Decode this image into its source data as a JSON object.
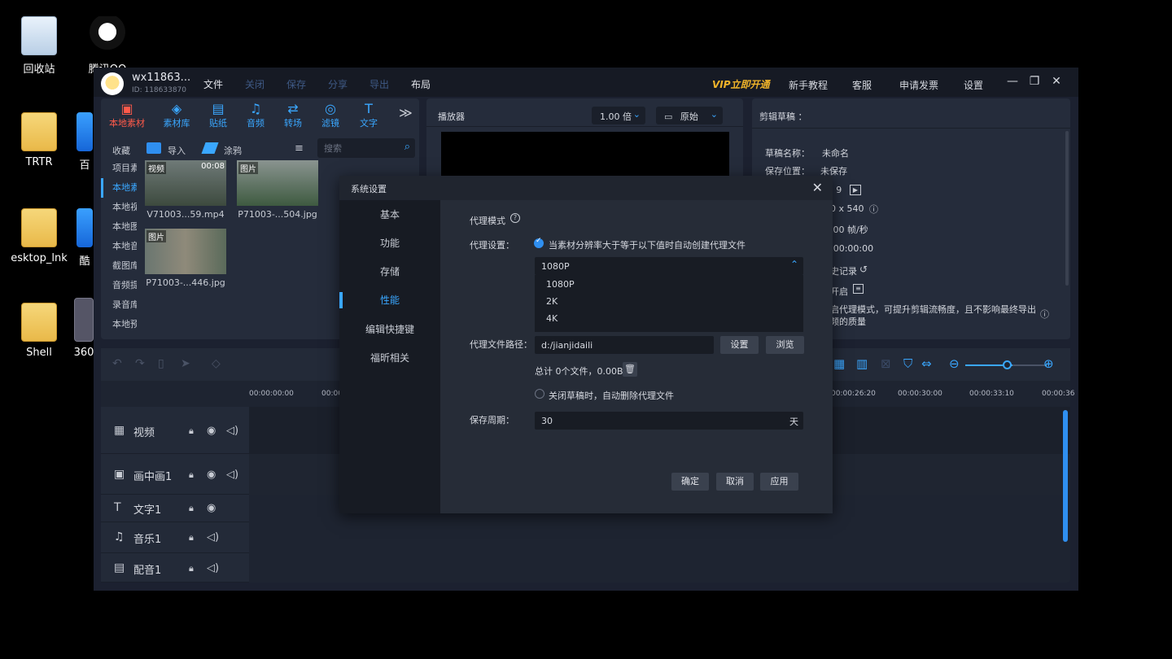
{
  "desktop": {
    "icons": [
      {
        "label": "回收站"
      },
      {
        "label": "腾讯QQ"
      },
      {
        "label": "TRTR"
      },
      {
        "label": "百"
      },
      {
        "label": "esktop_lnk"
      },
      {
        "label": "酷"
      },
      {
        "label": "Shell"
      },
      {
        "label": "360"
      }
    ]
  },
  "app": {
    "user": {
      "name": "wx11863...",
      "id": "ID: 118633870"
    },
    "menu": [
      "文件",
      "关闭",
      "保存",
      "分享",
      "导出",
      "布局"
    ],
    "vip": "VIP立即开通",
    "top_links": [
      "新手教程",
      "客服",
      "申请发票",
      "设置"
    ],
    "win_buttons": [
      "—",
      "❐",
      "✕"
    ]
  },
  "library": {
    "tabs": [
      {
        "label": "本地素材",
        "icon": "▣"
      },
      {
        "label": "素材库",
        "icon": "◈"
      },
      {
        "label": "贴纸",
        "icon": "▤"
      },
      {
        "label": "音频",
        "icon": "♫"
      },
      {
        "label": "转场",
        "icon": "⇄"
      },
      {
        "label": "滤镜",
        "icon": "◎"
      },
      {
        "label": "文字",
        "icon": "T"
      }
    ],
    "more": "≫",
    "collect": "收藏",
    "import": "导入",
    "brush": "涂鸦",
    "sort_icon": "≡",
    "search_placeholder": "搜索",
    "side": [
      "项目素",
      "本地素",
      "本地视",
      "本地图",
      "本地音",
      "截图库",
      "音频提",
      "录音库",
      "本地预"
    ],
    "items": [
      {
        "tag": "视频",
        "duration": "00:08",
        "caption": "V71003...59.mp4"
      },
      {
        "tag": "图片",
        "duration": "",
        "caption": "P71003-...504.jpg"
      },
      {
        "tag": "图片",
        "duration": "",
        "caption": "P71003-...446.jpg"
      }
    ]
  },
  "player": {
    "title": "播放器",
    "speed": "1.00 倍",
    "ratio": "原始"
  },
  "draft": {
    "title": "剪辑草稿",
    "colon": "：",
    "name_label": "草稿名称：",
    "name_value": "未命名",
    "location_label": "保存位置：",
    "location_value": "未保存",
    "partial": [
      ": 9",
      "0 x 540",
      ".00 帧/秒",
      ":00:00:00",
      "史记录",
      "开启"
    ],
    "desc_1": "启代理模式，可提升剪辑流畅度，且不影响最终导出",
    "desc_2": "频的质量"
  },
  "timeline": {
    "ruler": [
      "00:00:00:00",
      "00:00",
      "00:00:26:20",
      "00:00:30:00",
      "00:00:33:10",
      "00:00:36"
    ],
    "tracks": [
      {
        "icon": "▦",
        "name": "视频"
      },
      {
        "icon": "▣",
        "name": "画中画1"
      },
      {
        "icon": "T",
        "name": "文字1"
      },
      {
        "icon": "♫",
        "name": "音乐1"
      },
      {
        "icon": "▤",
        "name": "配音1"
      }
    ]
  },
  "dialog": {
    "title": "系统设置",
    "close": "✕",
    "nav": [
      "基本",
      "功能",
      "存储",
      "性能",
      "编辑快捷键",
      "福昕相关"
    ],
    "proxy_mode": "代理模式",
    "help": "?",
    "proxy_setting_label": "代理设置：",
    "proxy_auto": "当素材分辨率大于等于以下值时自动创建代理文件",
    "resolution_selected": "1080P",
    "resolution_options": [
      "1080P",
      "2K",
      "4K"
    ],
    "path_label": "代理文件路径：",
    "path_value": "d:/jianjidaili",
    "set_button": "设置",
    "browse_button": "浏览",
    "total": "总计 0个文件，0.00B",
    "auto_delete": "关闭草稿时，自动删除代理文件",
    "period_label": "保存周期：",
    "period_value": "30",
    "period_unit": "天",
    "ok": "确定",
    "cancel": "取消",
    "apply": "应用"
  }
}
